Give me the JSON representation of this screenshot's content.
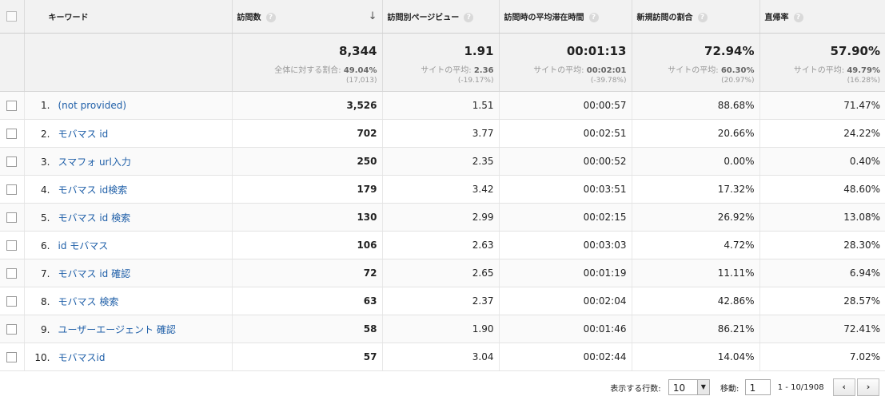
{
  "headers": {
    "keyword": "キーワード",
    "visits": "訪問数",
    "pages_per_visit": "訪問別ページビュー",
    "avg_duration": "訪問時の平均滞在時間",
    "new_visits": "新規訪問の割合",
    "bounce_rate": "直帰率",
    "help_glyph": "?",
    "sort_glyph": "↓"
  },
  "totals": {
    "visits": "8,344",
    "visits_sub_label": "全体に対する割合:",
    "visits_sub_value": "49.04%",
    "visits_diff": "(17,013)",
    "pages_per_visit": "1.91",
    "pages_sub_label": "サイトの平均:",
    "pages_sub_value": "2.36",
    "pages_diff": "(-19.17%)",
    "avg_duration": "00:01:13",
    "duration_sub_label": "サイトの平均:",
    "duration_sub_value": "00:02:01",
    "duration_diff": "(-39.78%)",
    "new_visits": "72.94%",
    "new_sub_label": "サイトの平均:",
    "new_sub_value": "60.30%",
    "new_diff": "(20.97%)",
    "bounce_rate": "57.90%",
    "bounce_sub_label": "サイトの平均:",
    "bounce_sub_value": "49.79%",
    "bounce_diff": "(16.28%)"
  },
  "rows": [
    {
      "rank": "1.",
      "keyword": "(not provided)",
      "visits": "3,526",
      "ppv": "1.51",
      "dur": "00:00:57",
      "new": "88.68%",
      "bounce": "71.47%"
    },
    {
      "rank": "2.",
      "keyword": "モバマス id",
      "visits": "702",
      "ppv": "3.77",
      "dur": "00:02:51",
      "new": "20.66%",
      "bounce": "24.22%"
    },
    {
      "rank": "3.",
      "keyword": "スマフォ url入力",
      "visits": "250",
      "ppv": "2.35",
      "dur": "00:00:52",
      "new": "0.00%",
      "bounce": "0.40%"
    },
    {
      "rank": "4.",
      "keyword": "モバマス id検索",
      "visits": "179",
      "ppv": "3.42",
      "dur": "00:03:51",
      "new": "17.32%",
      "bounce": "48.60%"
    },
    {
      "rank": "5.",
      "keyword": "モバマス id 検索",
      "visits": "130",
      "ppv": "2.99",
      "dur": "00:02:15",
      "new": "26.92%",
      "bounce": "13.08%"
    },
    {
      "rank": "6.",
      "keyword": "id モバマス",
      "visits": "106",
      "ppv": "2.63",
      "dur": "00:03:03",
      "new": "4.72%",
      "bounce": "28.30%"
    },
    {
      "rank": "7.",
      "keyword": "モバマス id 確認",
      "visits": "72",
      "ppv": "2.65",
      "dur": "00:01:19",
      "new": "11.11%",
      "bounce": "6.94%"
    },
    {
      "rank": "8.",
      "keyword": "モバマス 検索",
      "visits": "63",
      "ppv": "2.37",
      "dur": "00:02:04",
      "new": "42.86%",
      "bounce": "28.57%"
    },
    {
      "rank": "9.",
      "keyword": "ユーザーエージェント 確認",
      "visits": "58",
      "ppv": "1.90",
      "dur": "00:01:46",
      "new": "86.21%",
      "bounce": "72.41%"
    },
    {
      "rank": "10.",
      "keyword": "モバマスid",
      "visits": "57",
      "ppv": "3.04",
      "dur": "00:02:44",
      "new": "14.04%",
      "bounce": "7.02%"
    }
  ],
  "pager": {
    "rows_label": "表示する行数:",
    "rows_value": "10",
    "dropdown_glyph": "▼",
    "goto_label": "移動:",
    "goto_value": "1",
    "range": "1 - 10/1908",
    "prev_glyph": "‹",
    "next_glyph": "›"
  },
  "colors": {
    "link": "#1f5fa8",
    "header_bg": "#f2f2f2"
  }
}
